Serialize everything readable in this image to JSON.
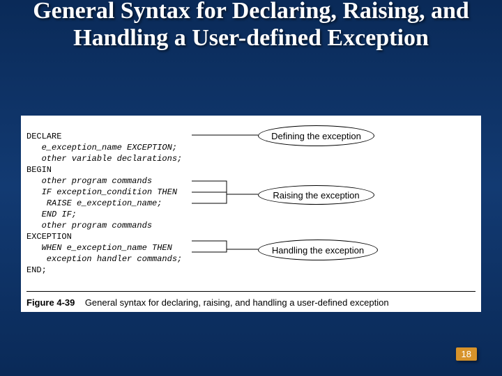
{
  "slide": {
    "title": "General Syntax for Declaring, Raising, and Handling a User-defined Exception",
    "page_number": "18"
  },
  "figure": {
    "number": "Figure 4-39",
    "caption": "General syntax for declaring, raising, and handling a user-defined exception",
    "labels": {
      "define": "Defining the exception",
      "raise": "Raising the exception",
      "handle": "Handling the exception"
    },
    "code": {
      "l1": "DECLARE",
      "l2": "   e_exception_name EXCEPTION;",
      "l3": "   other variable declarations;",
      "l4": "BEGIN",
      "l5": "   other program commands",
      "l6": "   IF exception_condition THEN",
      "l7": "    RAISE e_exception_name;",
      "l8": "   END IF;",
      "l9": "   other program commands",
      "l10": "EXCEPTION",
      "l11": "   WHEN e_exception_name THEN",
      "l12": "    exception handler commands;",
      "l13": "END;"
    }
  }
}
